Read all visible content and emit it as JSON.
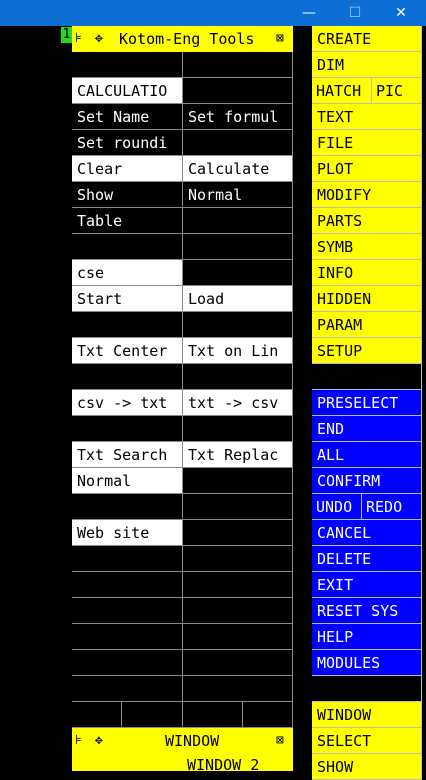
{
  "window": {
    "minimize_glyph": "—",
    "maximize_glyph": "☐",
    "close_glyph": "✕",
    "titlebar_color": "#0b6fd6"
  },
  "marker_label": "1",
  "tool_panel": {
    "title": "Kotom-Eng Tools",
    "pin_glyph": "⊧",
    "move_glyph": "✥",
    "close_glyph": "⊠",
    "rows": [
      {
        "left": {
          "text": "",
          "style": "black"
        },
        "right": {
          "text": "",
          "style": "black"
        }
      },
      {
        "left": {
          "text": "CALCULATIO",
          "style": "white"
        },
        "right": {
          "text": "",
          "style": "black"
        }
      },
      {
        "left": {
          "text": "Set Name",
          "style": "black"
        },
        "right": {
          "text": "Set formul",
          "style": "black"
        }
      },
      {
        "left": {
          "text": "Set roundi",
          "style": "black"
        },
        "right": {
          "text": "",
          "style": "black"
        }
      },
      {
        "left": {
          "text": "Clear",
          "style": "white"
        },
        "right": {
          "text": "Calculate",
          "style": "white"
        }
      },
      {
        "left": {
          "text": "Show",
          "style": "black"
        },
        "right": {
          "text": "Normal",
          "style": "black"
        }
      },
      {
        "left": {
          "text": "Table",
          "style": "black"
        },
        "right": {
          "text": "",
          "style": "black"
        }
      },
      {
        "left": {
          "text": "",
          "style": "black"
        },
        "right": {
          "text": "",
          "style": "black"
        }
      },
      {
        "left": {
          "text": "cse",
          "style": "white"
        },
        "right": {
          "text": "",
          "style": "black"
        }
      },
      {
        "left": {
          "text": "Start",
          "style": "white"
        },
        "right": {
          "text": "Load",
          "style": "white"
        }
      },
      {
        "left": {
          "text": "",
          "style": "black"
        },
        "right": {
          "text": "",
          "style": "black"
        }
      },
      {
        "left": {
          "text": "Txt Center",
          "style": "white"
        },
        "right": {
          "text": "Txt on Lin",
          "style": "white"
        }
      },
      {
        "left": {
          "text": "",
          "style": "black"
        },
        "right": {
          "text": "",
          "style": "black"
        }
      },
      {
        "left": {
          "text": "csv -> txt",
          "style": "white"
        },
        "right": {
          "text": "txt -> csv",
          "style": "white"
        }
      },
      {
        "left": {
          "text": "",
          "style": "black"
        },
        "right": {
          "text": "",
          "style": "black"
        }
      },
      {
        "left": {
          "text": "Txt Search",
          "style": "white"
        },
        "right": {
          "text": "Txt Replac",
          "style": "white"
        }
      },
      {
        "left": {
          "text": "Normal",
          "style": "white"
        },
        "right": {
          "text": "",
          "style": "black"
        }
      },
      {
        "left": {
          "text": "",
          "style": "black"
        },
        "right": {
          "text": "",
          "style": "black"
        }
      },
      {
        "left": {
          "text": "Web site",
          "style": "white"
        },
        "right": {
          "text": "",
          "style": "black"
        }
      },
      {
        "left": {
          "text": "",
          "style": "black"
        },
        "right": {
          "text": "",
          "style": "black"
        }
      },
      {
        "left": {
          "text": "",
          "style": "black"
        },
        "right": {
          "text": "",
          "style": "black"
        }
      },
      {
        "left": {
          "text": "",
          "style": "black"
        },
        "right": {
          "text": "",
          "style": "black"
        }
      },
      {
        "left": {
          "text": "",
          "style": "black"
        },
        "right": {
          "text": "",
          "style": "black"
        }
      },
      {
        "left": {
          "text": "",
          "style": "black"
        },
        "right": {
          "text": "",
          "style": "black"
        }
      },
      {
        "left": {
          "text": "",
          "style": "black"
        },
        "right": {
          "text": "",
          "style": "black"
        }
      }
    ],
    "split_rows": [
      {
        "cells": [
          "",
          "",
          "",
          ""
        ],
        "style": "black"
      },
      {
        "cells": [
          "",
          "",
          "",
          ""
        ],
        "style": "black"
      }
    ]
  },
  "window_panel": {
    "title": "WINDOW",
    "pin_glyph": "⊧",
    "move_glyph": "✥",
    "close_glyph": "⊠",
    "sub_label": "WINDOW 2"
  },
  "menu": [
    {
      "label": "CREATE",
      "style": "yellow"
    },
    {
      "label": "DIM",
      "style": "yellow"
    },
    {
      "split": true,
      "left": "HATCH",
      "right": "PIC",
      "style": "yellow"
    },
    {
      "label": "TEXT",
      "style": "yellow"
    },
    {
      "label": "FILE",
      "style": "yellow"
    },
    {
      "label": "PLOT",
      "style": "yellow"
    },
    {
      "label": "MODIFY",
      "style": "yellow"
    },
    {
      "label": "PARTS",
      "style": "yellow"
    },
    {
      "label": "SYMB",
      "style": "yellow"
    },
    {
      "label": "INFO",
      "style": "yellow"
    },
    {
      "label": "HIDDEN",
      "style": "yellow"
    },
    {
      "label": "PARAM",
      "style": "yellow"
    },
    {
      "label": "SETUP",
      "style": "yellow"
    },
    {
      "label": "",
      "style": "black"
    },
    {
      "label": "PRESELECT",
      "style": "blue"
    },
    {
      "label": "END",
      "style": "blue"
    },
    {
      "label": "ALL",
      "style": "blue"
    },
    {
      "label": "CONFIRM",
      "style": "blue"
    },
    {
      "split": true,
      "left": "UNDO",
      "right": "REDO",
      "style": "blue"
    },
    {
      "label": "CANCEL",
      "style": "blue"
    },
    {
      "label": "DELETE",
      "style": "blue"
    },
    {
      "label": "EXIT",
      "style": "blue"
    },
    {
      "label": "RESET SYS",
      "style": "blue"
    },
    {
      "label": "HELP",
      "style": "blue"
    },
    {
      "label": "MODULES",
      "style": "blue"
    },
    {
      "label": "",
      "style": "black"
    },
    {
      "label": "WINDOW",
      "style": "yellow"
    },
    {
      "label": "SELECT",
      "style": "yellow"
    },
    {
      "label": "SHOW",
      "style": "yellow"
    }
  ],
  "colors": {
    "menu_yellow": "#ffff00",
    "menu_blue": "#0000ff",
    "marker_green": "#1fdc1f"
  }
}
